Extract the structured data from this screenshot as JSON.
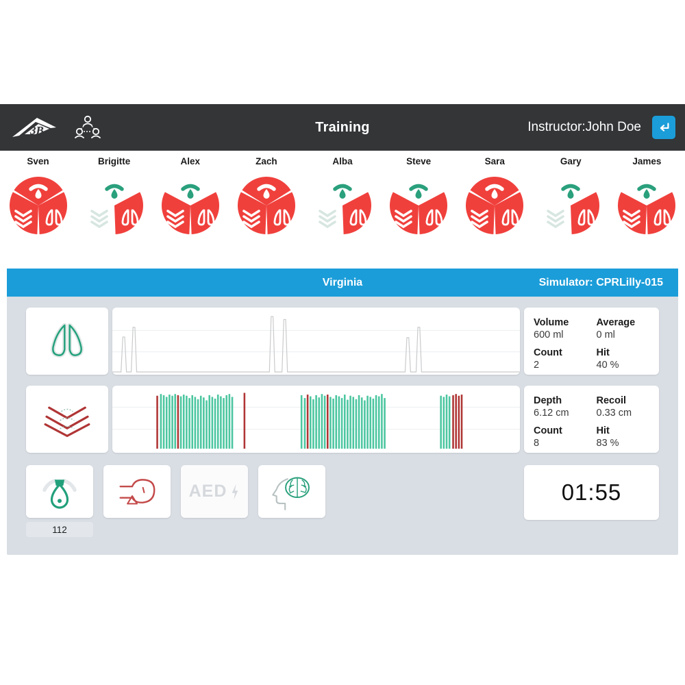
{
  "header": {
    "title": "Training",
    "instructor_label": "Instructor:John Doe",
    "logo_name": "3B",
    "logo_icon": "3b-logo-icon",
    "group_icon": "group-people-icon",
    "enter_icon": "enter-return-icon",
    "background": "#333537",
    "accent": "#1b9dd9"
  },
  "students": [
    {
      "name": "Sven",
      "pulse": "active",
      "compression": "active",
      "ventilation": "active"
    },
    {
      "name": "Brigitte",
      "pulse": "inactive",
      "compression": "inactive",
      "ventilation": "active"
    },
    {
      "name": "Alex",
      "pulse": "inactive",
      "compression": "active",
      "ventilation": "active"
    },
    {
      "name": "Zach",
      "pulse": "active",
      "compression": "active",
      "ventilation": "active"
    },
    {
      "name": "Alba",
      "pulse": "inactive",
      "compression": "inactive",
      "ventilation": "active"
    },
    {
      "name": "Steve",
      "pulse": "inactive",
      "compression": "active",
      "ventilation": "active"
    },
    {
      "name": "Sara",
      "pulse": "active",
      "compression": "active",
      "ventilation": "active"
    },
    {
      "name": "Gary",
      "pulse": "inactive",
      "compression": "inactive",
      "ventilation": "active"
    },
    {
      "name": "James",
      "pulse": "inactive",
      "compression": "active",
      "ventilation": "active"
    }
  ],
  "panel": {
    "patient_name": "Virginia",
    "simulator_label": "Simulator: CPRLilly-015"
  },
  "ventilation": {
    "icon": "lungs-icon",
    "stats": [
      {
        "key": "Volume",
        "value": "600  ml"
      },
      {
        "key": "Average",
        "value": "0  ml"
      },
      {
        "key": "Count",
        "value": "2"
      },
      {
        "key": "Hit",
        "value": "40  %"
      }
    ]
  },
  "compression": {
    "icon": "chevrons-icon",
    "stats": [
      {
        "key": "Depth",
        "value": "6.12  cm"
      },
      {
        "key": "Recoil",
        "value": "0.33  cm"
      },
      {
        "key": "Count",
        "value": "8"
      },
      {
        "key": "Hit",
        "value": "83  %"
      }
    ]
  },
  "tools": [
    {
      "icon": "pulse-oximeter-icon",
      "label": "",
      "badge": "112",
      "state": "active"
    },
    {
      "icon": "airway-head-icon",
      "label": "",
      "badge": "",
      "state": "active"
    },
    {
      "icon": "aed-icon",
      "label": "AED",
      "badge": "",
      "state": "disabled"
    },
    {
      "icon": "brain-icon",
      "label": "",
      "badge": "",
      "state": "active"
    }
  ],
  "timer": {
    "value": "01:55"
  },
  "chart_data": [
    {
      "type": "line",
      "title": "Ventilation waveform",
      "xlabel": "",
      "ylabel": "",
      "grid": true,
      "gridlines_y": [
        0.34,
        0.66
      ],
      "color": "#c9cacc",
      "ylim": [
        0,
        1
      ],
      "peaks": [
        {
          "x": 0.028,
          "y": 0.58
        },
        {
          "x": 0.053,
          "y": 0.74
        },
        {
          "x": 0.392,
          "y": 0.92
        },
        {
          "x": 0.423,
          "y": 0.87
        },
        {
          "x": 0.725,
          "y": 0.57
        },
        {
          "x": 0.752,
          "y": 0.74
        }
      ]
    },
    {
      "type": "bar",
      "title": "Compression depth bars",
      "xlabel": "",
      "ylabel": "",
      "grid": true,
      "gridlines_y": [
        0.35,
        0.68
      ],
      "good_color": "#4cc6a0",
      "bad_color": "#b03535",
      "ylim": [
        0,
        1
      ],
      "bars": [
        {
          "x": 0.108,
          "h": 0.92,
          "q": "bad"
        },
        {
          "x": 0.117,
          "h": 0.95,
          "q": "good"
        },
        {
          "x": 0.124,
          "h": 0.93,
          "q": "good"
        },
        {
          "x": 0.131,
          "h": 0.9,
          "q": "good"
        },
        {
          "x": 0.138,
          "h": 0.94,
          "q": "good"
        },
        {
          "x": 0.145,
          "h": 0.92,
          "q": "good"
        },
        {
          "x": 0.152,
          "h": 0.95,
          "q": "good"
        },
        {
          "x": 0.159,
          "h": 0.93,
          "q": "bad"
        },
        {
          "x": 0.166,
          "h": 0.91,
          "q": "good"
        },
        {
          "x": 0.173,
          "h": 0.94,
          "q": "good"
        },
        {
          "x": 0.18,
          "h": 0.92,
          "q": "good"
        },
        {
          "x": 0.187,
          "h": 0.88,
          "q": "good"
        },
        {
          "x": 0.194,
          "h": 0.93,
          "q": "good"
        },
        {
          "x": 0.201,
          "h": 0.9,
          "q": "good"
        },
        {
          "x": 0.208,
          "h": 0.86,
          "q": "good"
        },
        {
          "x": 0.215,
          "h": 0.92,
          "q": "good"
        },
        {
          "x": 0.222,
          "h": 0.89,
          "q": "good"
        },
        {
          "x": 0.229,
          "h": 0.84,
          "q": "good"
        },
        {
          "x": 0.236,
          "h": 0.93,
          "q": "good"
        },
        {
          "x": 0.243,
          "h": 0.9,
          "q": "good"
        },
        {
          "x": 0.25,
          "h": 0.87,
          "q": "good"
        },
        {
          "x": 0.257,
          "h": 0.94,
          "q": "good"
        },
        {
          "x": 0.264,
          "h": 0.91,
          "q": "good"
        },
        {
          "x": 0.271,
          "h": 0.88,
          "q": "good"
        },
        {
          "x": 0.278,
          "h": 0.93,
          "q": "good"
        },
        {
          "x": 0.285,
          "h": 0.95,
          "q": "good"
        },
        {
          "x": 0.292,
          "h": 0.9,
          "q": "good"
        },
        {
          "x": 0.322,
          "h": 0.97,
          "q": "bad"
        },
        {
          "x": 0.462,
          "h": 0.93,
          "q": "good"
        },
        {
          "x": 0.47,
          "h": 0.88,
          "q": "good"
        },
        {
          "x": 0.477,
          "h": 0.94,
          "q": "bad"
        },
        {
          "x": 0.484,
          "h": 0.91,
          "q": "good"
        },
        {
          "x": 0.491,
          "h": 0.86,
          "q": "good"
        },
        {
          "x": 0.498,
          "h": 0.93,
          "q": "good"
        },
        {
          "x": 0.505,
          "h": 0.89,
          "q": "good"
        },
        {
          "x": 0.512,
          "h": 0.95,
          "q": "good"
        },
        {
          "x": 0.519,
          "h": 0.92,
          "q": "good"
        },
        {
          "x": 0.526,
          "h": 0.94,
          "q": "bad"
        },
        {
          "x": 0.533,
          "h": 0.9,
          "q": "good"
        },
        {
          "x": 0.54,
          "h": 0.87,
          "q": "good"
        },
        {
          "x": 0.547,
          "h": 0.93,
          "q": "good"
        },
        {
          "x": 0.554,
          "h": 0.91,
          "q": "good"
        },
        {
          "x": 0.561,
          "h": 0.88,
          "q": "good"
        },
        {
          "x": 0.568,
          "h": 0.94,
          "q": "good"
        },
        {
          "x": 0.575,
          "h": 0.85,
          "q": "good"
        },
        {
          "x": 0.582,
          "h": 0.92,
          "q": "good"
        },
        {
          "x": 0.589,
          "h": 0.9,
          "q": "good"
        },
        {
          "x": 0.596,
          "h": 0.86,
          "q": "good"
        },
        {
          "x": 0.603,
          "h": 0.93,
          "q": "good"
        },
        {
          "x": 0.61,
          "h": 0.89,
          "q": "good"
        },
        {
          "x": 0.617,
          "h": 0.84,
          "q": "good"
        },
        {
          "x": 0.624,
          "h": 0.92,
          "q": "good"
        },
        {
          "x": 0.631,
          "h": 0.9,
          "q": "good"
        },
        {
          "x": 0.638,
          "h": 0.87,
          "q": "good"
        },
        {
          "x": 0.645,
          "h": 0.93,
          "q": "good"
        },
        {
          "x": 0.652,
          "h": 0.91,
          "q": "good"
        },
        {
          "x": 0.659,
          "h": 0.95,
          "q": "good"
        },
        {
          "x": 0.666,
          "h": 0.88,
          "q": "good"
        },
        {
          "x": 0.804,
          "h": 0.92,
          "q": "good"
        },
        {
          "x": 0.811,
          "h": 0.9,
          "q": "good"
        },
        {
          "x": 0.818,
          "h": 0.94,
          "q": "good"
        },
        {
          "x": 0.825,
          "h": 0.91,
          "q": "good"
        },
        {
          "x": 0.834,
          "h": 0.93,
          "q": "bad"
        },
        {
          "x": 0.841,
          "h": 0.95,
          "q": "bad"
        },
        {
          "x": 0.848,
          "h": 0.92,
          "q": "bad"
        },
        {
          "x": 0.855,
          "h": 0.94,
          "q": "bad"
        }
      ]
    }
  ]
}
